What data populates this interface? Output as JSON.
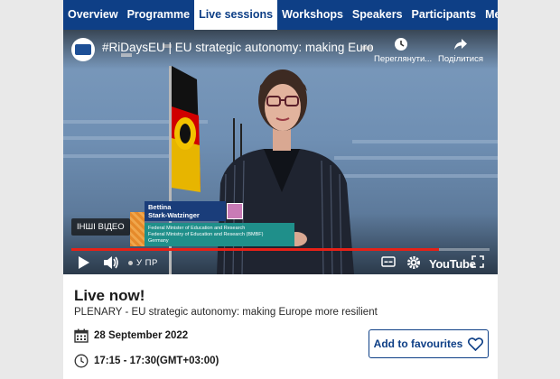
{
  "nav": {
    "items": [
      {
        "label": "Overview",
        "active": false
      },
      {
        "label": "Programme",
        "active": false
      },
      {
        "label": "Live sessions",
        "active": true
      },
      {
        "label": "Workshops",
        "active": false
      },
      {
        "label": "Speakers",
        "active": false
      },
      {
        "label": "Participants",
        "active": false
      },
      {
        "label": "Messages",
        "active": false
      }
    ],
    "color": "#0e3f86"
  },
  "video": {
    "title": "#RiDaysEU | EU strategic autonomy: making Europe ...",
    "watch_later_label": "Переглянути...",
    "share_label": "Поділитися",
    "more_videos_label": "ІНШІ ВІДЕО",
    "live_label": "У ПР",
    "platform_logo": "YouTube",
    "progress_percent": 88,
    "lower_third": {
      "name_line1": "Bettina",
      "name_line2": "Stark-Watzinger",
      "role_line1": "Federal Minister of Education and Research",
      "role_line2": "Federal Ministry of Education and Research (BMBF)",
      "role_line3": "Germany"
    },
    "icons": [
      "clock-icon",
      "share-icon",
      "play-icon",
      "volume-icon",
      "subtitles-icon",
      "settings-gear-icon",
      "fullscreen-icon"
    ]
  },
  "session": {
    "status": "Live now!",
    "title": "PLENARY - EU strategic autonomy: making Europe more resilient",
    "date": "28 September 2022",
    "time": "17:15 - 17:30(GMT+03:00)",
    "favourite_label": "Add to favourites"
  }
}
